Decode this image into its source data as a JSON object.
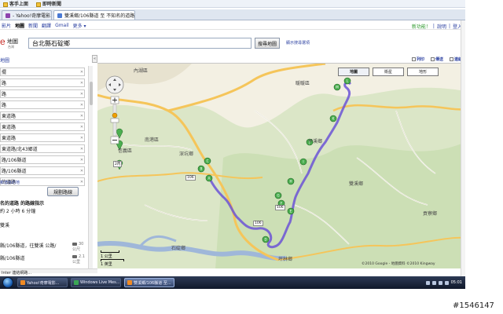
{
  "browser": {
    "toolbar": {
      "items": [
        "客手上面",
        "即時新聞"
      ]
    },
    "tabs": [
      {
        "label": "- Yahoo!奇摩電影..."
      },
      {
        "label": "雙溪鄉/106縣道 至 不知名的道路 - ..."
      }
    ]
  },
  "gnav": {
    "items": [
      "影片",
      "地圖",
      "新聞",
      "翻譯",
      "Gmail",
      "更多 ▾"
    ],
    "current_index": 1,
    "right_new": "新功能！",
    "right_links": [
      "說明",
      "登入"
    ]
  },
  "search": {
    "logo_letter": "e",
    "logo_text": "地圖",
    "logo_sub": "台灣",
    "input_value": "台北縣石碇鄉",
    "button_label": "搜尋地圖",
    "options_link": "顯示搜尋選項"
  },
  "left_panel": {
    "top_link": "地圖",
    "toggle": "«",
    "rows": [
      "擺",
      "路",
      "路",
      "路",
      "東道路",
      "東道路",
      "東道路",
      "東道路/北43郷道",
      "路/106縣道",
      "路/106縣道",
      "的道路"
    ],
    "add_destination": "新增目的地",
    "get_directions_label": "規劃路線",
    "route_title": "名的道路 的路線指示",
    "route_summary": "約 2 小時 6 分鐘",
    "start_label": "雙溪",
    "steps": [
      {
        "text": "縣/106縣道，往雙溪 公路/",
        "distance": "30 公尺"
      },
      {
        "text": "縣/106縣道",
        "distance": "2.1 公里"
      }
    ],
    "status_text": "Inter 連結網路..."
  },
  "map_header": {
    "links": [
      "列印",
      "傳送",
      "連結"
    ]
  },
  "map": {
    "type_buttons": [
      {
        "label": "地圖",
        "active": true
      },
      {
        "label": "衛星",
        "active": false
      },
      {
        "label": "地形",
        "active": false
      }
    ],
    "towns": [
      {
        "label": "內湖區"
      },
      {
        "label": "南港區"
      },
      {
        "label": "信義區"
      },
      {
        "label": "深坑鄉"
      },
      {
        "label": "石碇鄉"
      },
      {
        "label": "暖暖區"
      },
      {
        "label": "平溪鄉"
      },
      {
        "label": "雙溪鄉"
      },
      {
        "label": "坪林鄉"
      },
      {
        "label": "貢寮鄉"
      }
    ],
    "route_markers": [
      "M",
      "L",
      "K",
      "J",
      "I",
      "H",
      "G",
      "F",
      "E",
      "D",
      "C",
      "B",
      "A"
    ],
    "road_numbers": [
      "106",
      "2丙",
      "106",
      "106"
    ],
    "scale_top": "1 公里",
    "scale_bottom": "1 英里",
    "copyright": "©2010 Google - 地圖資料 ©2010 Kingway",
    "colors": {
      "land": "#f3f0e3",
      "green": "#c8ddb0",
      "river": "#9fb7d9",
      "road_main": "#f5c55a",
      "road_minor": "#ffffff",
      "route": "#6b54d6"
    }
  },
  "taskbar": {
    "buttons": [
      {
        "label": "Yahoo!奇摩電影..."
      },
      {
        "label": "Windows Live Mes..."
      },
      {
        "label": "雙溪鄉/106縣道 至..."
      }
    ],
    "clock": "05:01"
  },
  "watermark": "#1546147"
}
